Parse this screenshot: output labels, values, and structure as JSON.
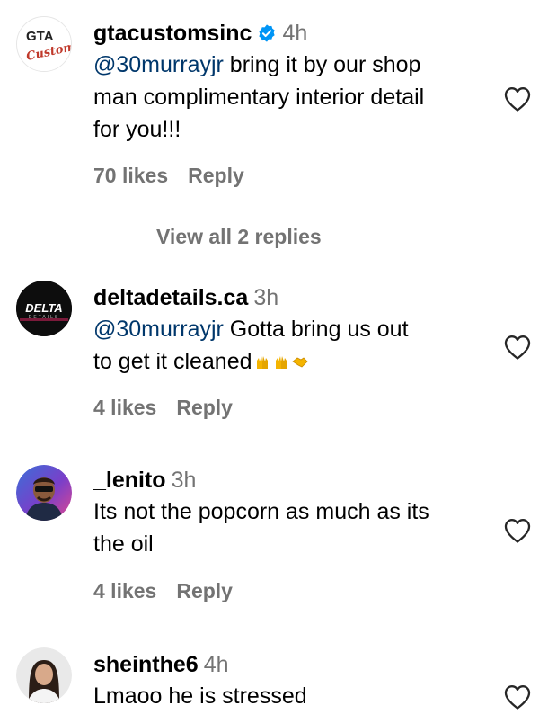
{
  "comments": [
    {
      "username": "gtacustomsinc",
      "time": "4h",
      "mention": "@30murrayjr",
      "text_1": " bring it by our shop",
      "text_2": "man complimentary interior detail",
      "text_3": "for you!!!",
      "likes": "70 likes",
      "reply": "Reply",
      "verified": true,
      "avatar_text": "GTA",
      "avatar_script": "Customs"
    },
    {
      "username": "deltadetails.ca",
      "time": "3h",
      "mention": "@30murrayjr",
      "text_1": " Gotta bring us out",
      "text_2": "to get it cleaned",
      "likes": "4 likes",
      "reply": "Reply",
      "avatar_text": "DELTA",
      "avatar_sub": "DETAILS"
    },
    {
      "username": "_lenito",
      "time": "3h",
      "text_1": "Its not the popcorn as much as its",
      "text_2": "the oil",
      "likes": "4 likes",
      "reply": "Reply"
    },
    {
      "username": "sheinthe6",
      "time": "4h",
      "text_1": "Lmaoo he is stressed"
    }
  ],
  "view_replies": "View all 2 replies",
  "colors": {
    "mention": "#00376b",
    "secondary": "#737373",
    "verified": "#0095f6"
  },
  "icons": [
    "heart-outline-icon",
    "verified-badge-icon",
    "raising-hands-emoji",
    "handshake-emoji"
  ]
}
